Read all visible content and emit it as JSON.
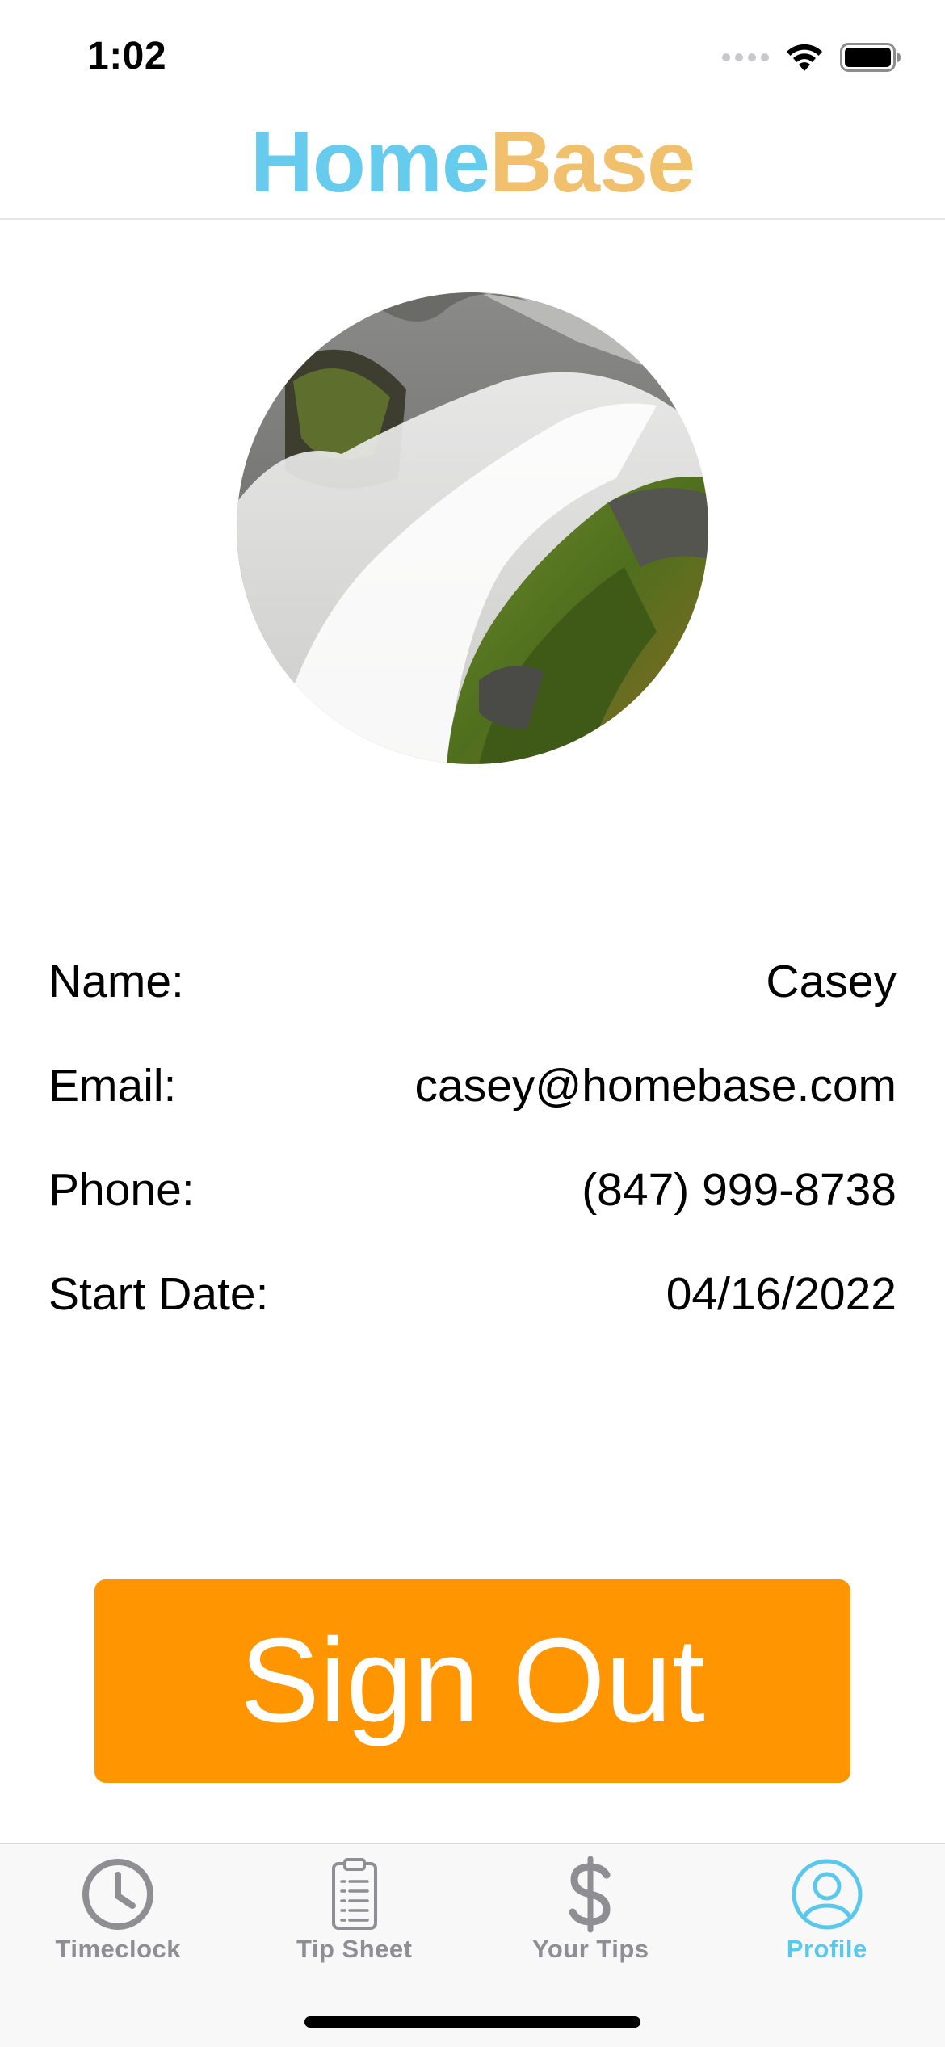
{
  "status_bar": {
    "time": "1:02"
  },
  "header": {
    "title_part1": "Home",
    "title_part2": "Base"
  },
  "colors": {
    "home": "#67CBEE",
    "base": "#F1C06C",
    "accent": "#FF9500",
    "active_tab": "#5AC8EC",
    "inactive_tab": "#8E8E93"
  },
  "profile": {
    "fields": [
      {
        "label": "Name:",
        "value": "Casey"
      },
      {
        "label": "Email:",
        "value": "casey@homebase.com"
      },
      {
        "label": "Phone:",
        "value": "(847) 999-8738"
      },
      {
        "label": "Start Date:",
        "value": "04/16/2022"
      }
    ]
  },
  "actions": {
    "sign_out_label": "Sign Out"
  },
  "tab_bar": {
    "tabs": [
      {
        "label": "Timeclock",
        "icon": "clock-icon",
        "active": false
      },
      {
        "label": "Tip Sheet",
        "icon": "clipboard-icon",
        "active": false
      },
      {
        "label": "Your Tips",
        "icon": "dollar-icon",
        "active": false
      },
      {
        "label": "Profile",
        "icon": "profile-icon",
        "active": true
      }
    ]
  }
}
